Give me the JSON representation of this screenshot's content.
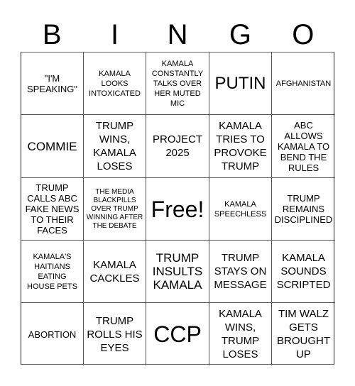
{
  "header": {
    "letters": [
      "B",
      "I",
      "N",
      "G",
      "O"
    ]
  },
  "grid": {
    "cells": [
      "\"I'M SPEAKING\"",
      "KAMALA LOOKS INTOXICATED",
      "KAMALA CONSTANTLY TALKS OVER HER MUTED MIC",
      "PUTIN",
      "AFGHANISTAN",
      "COMMIE",
      "TRUMP WINS, KAMALA LOSES",
      "PROJECT 2025",
      "KAMALA TRIES TO PROVOKE TRUMP",
      "ABC ALLOWS KAMALA TO BEND THE RULES",
      "TRUMP CALLS ABC FAKE NEWS TO THEIR FACES",
      "THE MEDIA BLACKPILLS OVER TRUMP WINNING AFTER THE DEBATE",
      "Free!",
      "KAMALA SPEECHLESS",
      "TRUMP REMAINS DISCIPLINED",
      "KAMALA'S HAITIANS EATING HOUSE PETS",
      "KAMALA CACKLES",
      "TRUMP INSULTS KAMALA",
      "TRUMP STAYS ON MESSAGE",
      "KAMALA SOUNDS SCRIPTED",
      "ABORTION",
      "TRUMP ROLLS HIS EYES",
      "CCP",
      "KAMALA WINS, TRUMP LOSES",
      "TIM WALZ GETS BROUGHT UP"
    ]
  }
}
